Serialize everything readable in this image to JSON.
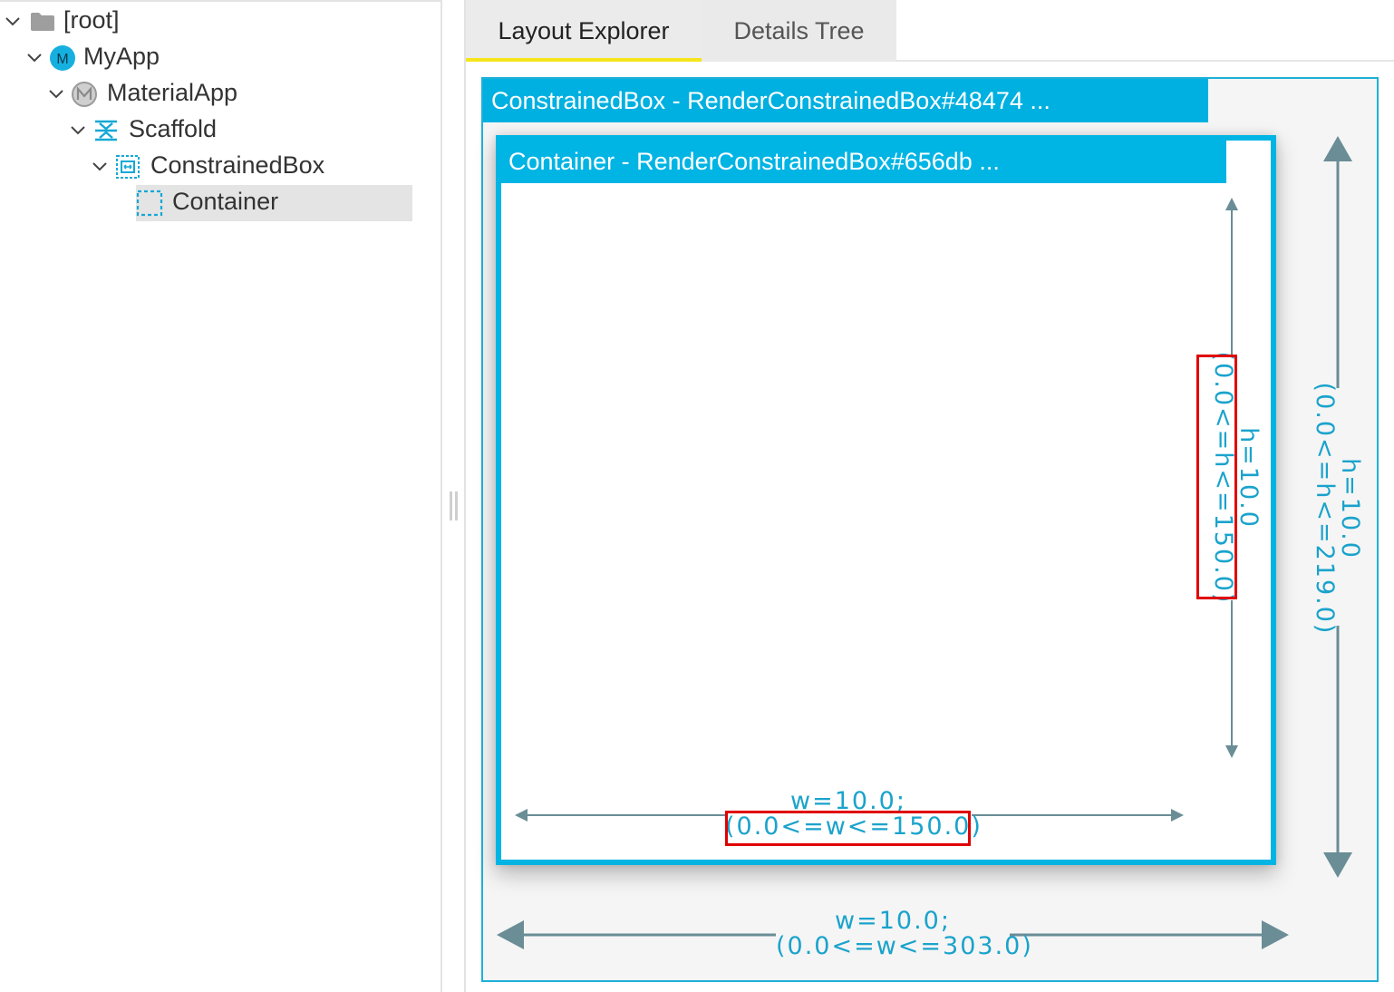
{
  "tree": {
    "items": [
      {
        "label": "[root]",
        "icon": "folder-icon",
        "expanded": true
      },
      {
        "label": "MyApp",
        "icon": "myapp-icon",
        "icon_text": "M",
        "expanded": true
      },
      {
        "label": "MaterialApp",
        "icon": "material-app-icon",
        "expanded": true
      },
      {
        "label": "Scaffold",
        "icon": "scaffold-icon",
        "expanded": true
      },
      {
        "label": "ConstrainedBox",
        "icon": "constrained-box-icon",
        "expanded": true
      },
      {
        "label": "Container",
        "icon": "container-icon",
        "selected": true
      }
    ]
  },
  "tabs": [
    {
      "label": "Layout Explorer",
      "active": true
    },
    {
      "label": "Details Tree",
      "active": false
    }
  ],
  "layout": {
    "outer": {
      "title": "ConstrainedBox - RenderConstrainedBox#48474 ...",
      "width_line1": "w=10.0;",
      "width_line2": "(0.0<=w<=303.0)",
      "height_line1": "h=10.0",
      "height_line2": "(0.0<=h<=219.0)"
    },
    "inner": {
      "title": "Container - RenderConstrainedBox#656db ...",
      "width_line1": "w=10.0;",
      "width_line2": "(0.0<=w<=150.0)",
      "height_line1": "h=10.0",
      "height_line2": "(0.0<=h<=150.0)"
    }
  },
  "colors": {
    "accent": "#00b4e4",
    "arrow": "#6a8d96",
    "highlight": "#e00000",
    "tab_indicator": "#f5e51b"
  }
}
